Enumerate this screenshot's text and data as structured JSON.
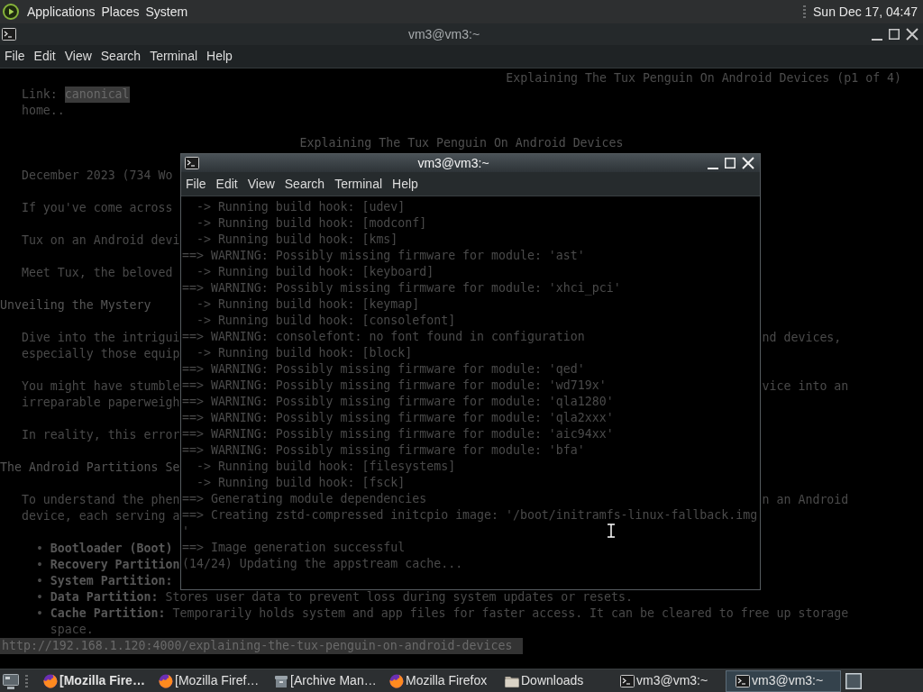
{
  "top_panel": {
    "menus": [
      "Applications",
      "Places",
      "System"
    ],
    "clock": "Sun Dec 17, 04:47"
  },
  "back_window": {
    "title": "vm3@vm3:~",
    "active": false,
    "menu": [
      "File",
      "Edit",
      "View",
      "Search",
      "Terminal",
      "Help"
    ],
    "page": [
      {
        "kind": "page_header",
        "text": "Explaining The Tux Penguin On Android Devices (p1 of 4)"
      },
      {
        "kind": "link_row",
        "label": "Link:",
        "link": {
          "text": "canonical",
          "selected": true
        }
      },
      {
        "kind": "nav",
        "text": "home.."
      },
      {
        "kind": "title",
        "text": "Explaining The Tux Penguin On Android Devices"
      },
      {
        "kind": "paragraph",
        "lines": [
          {
            "left": "December 2023 (734 Wo"
          }
        ]
      },
      {
        "kind": "paragraph",
        "lines": [
          {
            "left": "If you've come across"
          }
        ]
      },
      {
        "kind": "paragraph",
        "lines": [
          {
            "left": "Tux on an Android devi"
          }
        ]
      },
      {
        "kind": "paragraph",
        "lines": [
          {
            "left": "Meet Tux, the beloved"
          }
        ]
      },
      {
        "kind": "heading",
        "text": "Unveiling the Mystery"
      },
      {
        "kind": "paragraph",
        "lines": [
          {
            "left": "Dive into the intrigui",
            "right": "nd devices,"
          },
          {
            "left": "especially those equip"
          }
        ]
      },
      {
        "kind": "paragraph",
        "lines": [
          {
            "left": "You might have stumble",
            "right": "vice into an"
          },
          {
            "left": "irreparable paperweigh"
          }
        ]
      },
      {
        "kind": "paragraph",
        "lines": [
          {
            "left": "In reality, this error"
          }
        ]
      },
      {
        "kind": "heading",
        "text": "The Android Partitions Se"
      },
      {
        "kind": "paragraph",
        "lines": [
          {
            "left": "To understand the phen",
            "right": "n an Android"
          },
          {
            "left": "device, each serving a"
          }
        ]
      },
      {
        "kind": "bullets",
        "items": [
          {
            "marker": "•",
            "term": "Bootloader (Boot)"
          },
          {
            "marker": "•",
            "term": "Recovery Partition"
          },
          {
            "marker": "•",
            "term": "System Partition:"
          },
          {
            "marker": "•",
            "term": "Data Partition:",
            "text": "Stores user data to prevent loss during system updates or resets."
          },
          {
            "marker": "•",
            "term": "Cache Partition:",
            "text": "Temporarily holds system and app files for faster access. It can be cleared to free up storage space."
          }
        ]
      }
    ],
    "status_url": "http://192.168.1.120:4000/explaining-the-tux-penguin-on-android-devices"
  },
  "front_window": {
    "title": "vm3@vm3:~",
    "active": true,
    "menu": [
      "File",
      "Edit",
      "View",
      "Search",
      "Terminal",
      "Help"
    ],
    "lines": [
      {
        "kind": "sub",
        "text": "-> Running build hook: [udev]"
      },
      {
        "kind": "sub",
        "text": "-> Running build hook: [modconf]"
      },
      {
        "kind": "sub",
        "text": "-> Running build hook: [kms]"
      },
      {
        "kind": "main",
        "text": "==> WARNING: Possibly missing firmware for module: 'ast'"
      },
      {
        "kind": "sub",
        "text": "-> Running build hook: [keyboard]"
      },
      {
        "kind": "main",
        "text": "==> WARNING: Possibly missing firmware for module: 'xhci_pci'"
      },
      {
        "kind": "sub",
        "text": "-> Running build hook: [keymap]"
      },
      {
        "kind": "sub",
        "text": "-> Running build hook: [consolefont]"
      },
      {
        "kind": "main",
        "text": "==> WARNING: consolefont: no font found in configuration"
      },
      {
        "kind": "sub",
        "text": "-> Running build hook: [block]"
      },
      {
        "kind": "main",
        "text": "==> WARNING: Possibly missing firmware for module: 'qed'"
      },
      {
        "kind": "main",
        "text": "==> WARNING: Possibly missing firmware for module: 'wd719x'"
      },
      {
        "kind": "main",
        "text": "==> WARNING: Possibly missing firmware for module: 'qla1280'"
      },
      {
        "kind": "main",
        "text": "==> WARNING: Possibly missing firmware for module: 'qla2xxx'"
      },
      {
        "kind": "main",
        "text": "==> WARNING: Possibly missing firmware for module: 'aic94xx'"
      },
      {
        "kind": "main",
        "text": "==> WARNING: Possibly missing firmware for module: 'bfa'"
      },
      {
        "kind": "sub",
        "text": "-> Running build hook: [filesystems]"
      },
      {
        "kind": "sub",
        "text": "-> Running build hook: [fsck]"
      },
      {
        "kind": "main",
        "text": "==> Generating module dependencies"
      },
      {
        "kind": "main",
        "text": "==> Creating zstd-compressed initcpio image: '/boot/initramfs-linux-fallback.img"
      },
      {
        "kind": "main",
        "text": "'"
      },
      {
        "kind": "main",
        "text": "==> Image generation successful"
      },
      {
        "kind": "main",
        "text": "(14/24) Updating the appstream cache..."
      }
    ]
  },
  "taskbar": {
    "items": [
      {
        "kind": "browser",
        "label": "[Mozilla Fire…",
        "selected": false,
        "attention": true
      },
      {
        "kind": "browser",
        "label": "[Mozilla Firef…",
        "selected": false,
        "attention": false
      },
      {
        "kind": "archive",
        "label": "[Archive Man…",
        "selected": false,
        "attention": false
      },
      {
        "kind": "browser",
        "label": "Mozilla Firefox",
        "selected": false,
        "attention": false
      },
      {
        "kind": "folder",
        "label": "Downloads",
        "selected": false,
        "attention": false
      },
      {
        "kind": "terminal",
        "label": "vm3@vm3:~",
        "selected": false,
        "attention": false
      },
      {
        "kind": "terminal",
        "label": "vm3@vm3:~",
        "selected": true,
        "attention": false
      }
    ]
  }
}
